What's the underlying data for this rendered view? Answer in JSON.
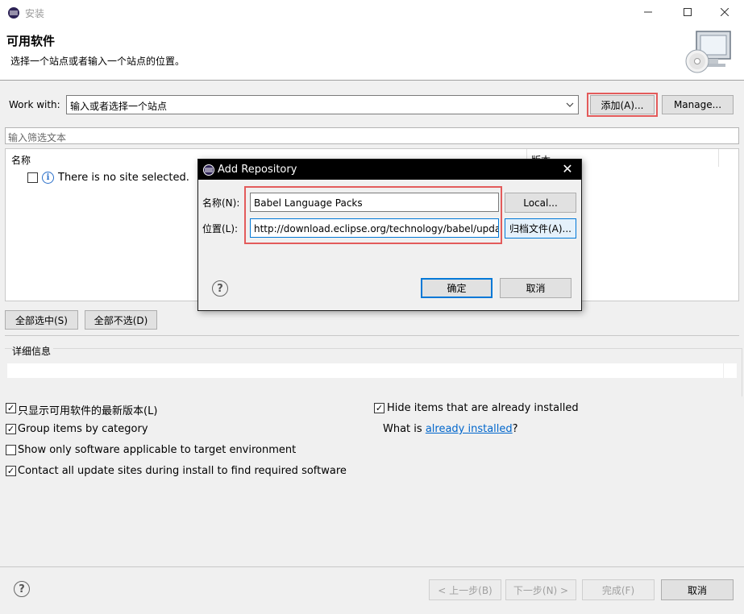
{
  "window": {
    "title": "安装"
  },
  "header": {
    "title": "可用软件",
    "description": "选择一个站点或者输入一个站点的位置。"
  },
  "work_with": {
    "label": "Work with:",
    "placeholder": "输入或者选择一个站点",
    "add_button": "添加(A)...",
    "manage_button": "Manage..."
  },
  "filter": {
    "placeholder": "输入筛选文本"
  },
  "tree": {
    "columns": [
      "名称",
      "版本"
    ],
    "rows": [
      {
        "label": "There is no site selected.",
        "checked": false,
        "icon": "info-icon"
      }
    ]
  },
  "selection": {
    "select_all": "全部选中(S)",
    "deselect_all": "全部不选(D)"
  },
  "details": {
    "label": "详细信息"
  },
  "options": {
    "latest_only": {
      "label": "只显示可用软件的最新版本(L)",
      "checked": true
    },
    "group_by_category": {
      "label": "Group items by category",
      "checked": true
    },
    "target_env": {
      "label": "Show only software applicable to target environment",
      "checked": false
    },
    "contact_all": {
      "label": "Contact all update sites during install to find required software",
      "checked": true
    },
    "hide_installed": {
      "label": "Hide items that are already installed",
      "checked": true
    },
    "what_is_prefix": "What is ",
    "what_is_link": "already installed",
    "what_is_suffix": "?"
  },
  "footer": {
    "back": "< 上一步(B)",
    "next": "下一步(N) >",
    "finish": "完成(F)",
    "cancel": "取消"
  },
  "dialog": {
    "title": "Add Repository",
    "name_label": "名称(N):",
    "location_label": "位置(L):",
    "name_value": "Babel Language Packs",
    "location_value": "http://download.eclipse.org/technology/babel/update-site/",
    "local_button": "Local...",
    "archive_button": "归档文件(A)...",
    "ok_button": "确定",
    "cancel_button": "取消"
  },
  "colors": {
    "highlight": "#e35b5b",
    "accent": "#0078d7",
    "link": "#0066cc"
  }
}
